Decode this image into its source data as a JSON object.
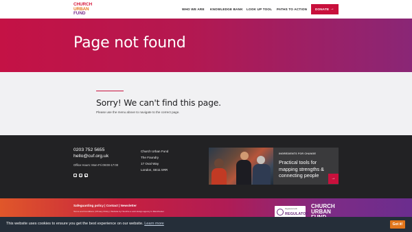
{
  "header": {
    "logo": {
      "line1": "CHURCH",
      "line2": "URBAN",
      "line3": "FUND"
    },
    "nav": [
      {
        "label": "WHO WE ARE"
      },
      {
        "label": "KNOWLEDGE BANK"
      },
      {
        "label": "LOOK UP TOOL"
      },
      {
        "label": "PATHS TO ACTION"
      }
    ],
    "donate_label": "DONATE",
    "donate_arrow": "→"
  },
  "hero": {
    "title": "Page not found"
  },
  "content": {
    "heading": "Sorry! We can't find this page.",
    "body": "Please use the menu above to navigate to the correct page."
  },
  "footer": {
    "phone": "0203 752 5655",
    "email": "hello@cuf.org.uk",
    "hours": "Office Hours: Mon-Fri 09:00-17:00",
    "socials": [
      "facebook-icon",
      "instagram-icon",
      "youtube-icon"
    ],
    "address": [
      "Church Urban Fund",
      "The Foundry",
      "17 Oval Way",
      "London, SE11 5RR"
    ],
    "card": {
      "kicker": "INGREDIENTS FOR CHANGE",
      "title": "Practical tools for mapping strengths & connecting people",
      "arrow": "→"
    }
  },
  "band": {
    "links": "Safeguarding policy | Contact | Newsletter",
    "small": "Terms and Conditions | Privacy Policy | Website by Hoochie a web design agency in Manchester",
    "regulator_top": "Registered with",
    "regulator_main": "REGULATOR",
    "logo": {
      "line1": "CHURCH",
      "line2": "URBAN",
      "line3": "FUND"
    }
  },
  "cookie": {
    "message": "This website uses cookies to ensure you get the best experience on our website.",
    "more_label": "Learn more",
    "button_label": "Got it!"
  },
  "colors": {
    "accent": "#c8103c",
    "footer_bg": "#222224",
    "cookie_bg": "#252e39",
    "cookie_button": "#e2761b"
  }
}
